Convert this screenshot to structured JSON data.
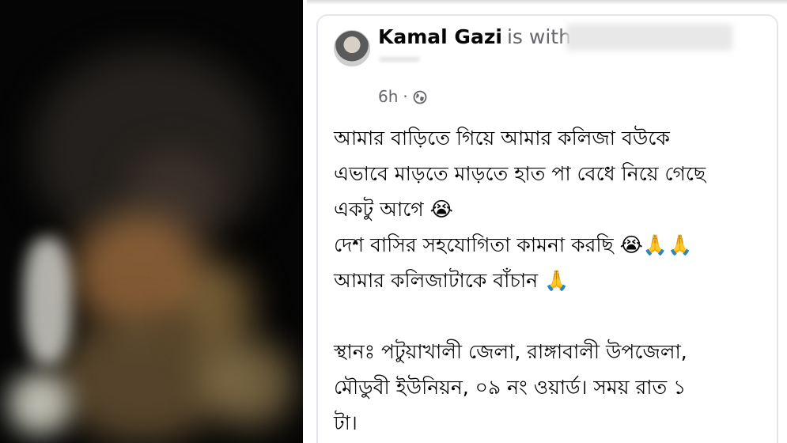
{
  "post": {
    "author": "Kamal Gazi",
    "with_label": "is with",
    "time": "6h",
    "separator": "·",
    "privacy_icon": "globe-icon",
    "lines": [
      "আমার বাড়িতে গিয়ে আমার কলিজা বউকে",
      "এভাবে  মাড়তে মাড়তে হাত পা বেধে নিয়ে গেছে",
      "একটু আগে 😭",
      "দেশ বাসির সহযোগিতা কামনা করছি 😭🙏🙏",
      "আমার কলিজাটাকে বাঁচান 🙏",
      "",
      "স্থানঃ পটুয়াখালী জেলা, রাঙ্গাবালী উপজেলা,",
      "মৌডুবী ইউনিয়ন, ০৯ নং ওয়ার্ড। সময় রাত ১",
      "টা।"
    ]
  },
  "colors": {
    "name": "#050505",
    "secondary": "#65676b",
    "card_border": "#e4e6eb"
  }
}
